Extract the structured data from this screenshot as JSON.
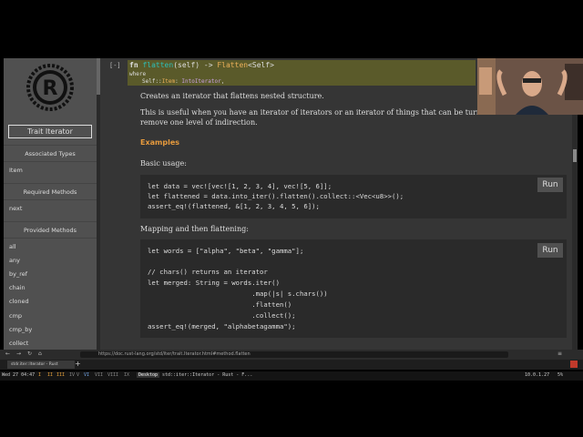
{
  "sidebar": {
    "trait_title": "Trait Iterator",
    "sections": [
      {
        "heading": "Associated Types",
        "items": [
          "Item"
        ]
      },
      {
        "heading": "Required Methods",
        "items": [
          "next"
        ]
      },
      {
        "heading": "Provided Methods",
        "items": [
          "all",
          "any",
          "by_ref",
          "chain",
          "cloned",
          "cmp",
          "cmp_by",
          "collect"
        ]
      }
    ]
  },
  "signature": {
    "collapse": "[-]",
    "fn_kw": "fn",
    "fn_name": "flatten",
    "params": "(self) -> ",
    "ret_type": "Flatten",
    "ret_generic": "<Self>",
    "where_kw": "where",
    "bound_self": "Self::",
    "bound_item": "Item",
    "bound_colon": ": ",
    "bound_trait": "IntoIterator",
    "bound_end": ","
  },
  "doc": {
    "summary": "Creates an iterator that flattens nested structure.",
    "desc_line1": "This is useful when you have an iterator of iterators or an iterator of things that can be turned into",
    "desc_line2": "remove one level of indirection.",
    "examples_heading": "Examples",
    "basic_usage": "Basic usage:",
    "mapping_label": "Mapping and then flattening:",
    "run_label": "Run"
  },
  "code1": [
    "let data = vec![vec![1, 2, 3, 4], vec![5, 6]];",
    "let flattened = data.into_iter().flatten().collect::<Vec<u8>>();",
    "assert_eq!(flattened, &[1, 2, 3, 4, 5, 6]);"
  ],
  "code2": [
    "let words = [\"alpha\", \"beta\", \"gamma\"];",
    "",
    "// chars() returns an iterator",
    "let merged: String = words.iter()",
    "                          .map(|s| s.chars())",
    "                          .flatten()",
    "                          .collect();",
    "assert_eq!(merged, \"alphabetagamma\");"
  ],
  "browser": {
    "url": "https://doc.rust-lang.org/std/iter/trait.Iterator.html#method.flatten",
    "tab_title": "stdr.iter::Iterator - Rust",
    "new_tab": "+"
  },
  "taskbar": {
    "datetime": "Wed 27 04:47",
    "workspaces": [
      "I",
      "II",
      "III",
      "IV",
      "V",
      "VI",
      "VII",
      "VIII",
      "IX"
    ],
    "desktop": "Desktop",
    "window": "std::iter::Iterator - Rust - F...",
    "ip": "10.0.1.27",
    "battery": "5%"
  },
  "colors": {
    "sidebar_bg": "#505050",
    "main_bg": "#353535",
    "code_bg": "#2a2a2a",
    "heading": "#e69a3d",
    "fn_name": "#2dbfb8",
    "type": "#ecb05a"
  }
}
